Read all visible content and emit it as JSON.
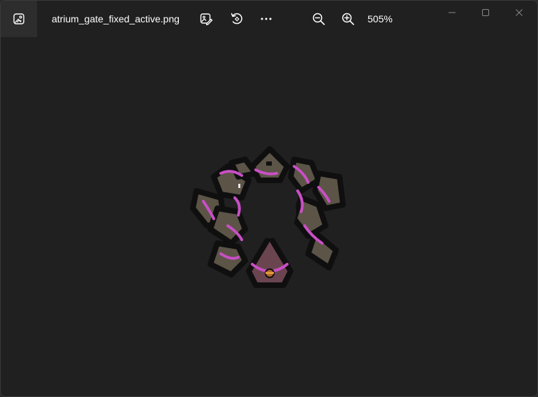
{
  "window": {
    "title": "atrium_gate_fixed_active.png",
    "zoom_level": "505%"
  },
  "toolbar": {
    "icons": [
      "photos-app-icon",
      "edit-image-icon",
      "rotate-icon",
      "more-icon",
      "zoom-out-icon",
      "zoom-in-icon"
    ]
  },
  "window_controls": [
    "minimize-icon",
    "maximize-icon",
    "close-icon"
  ],
  "colors": {
    "background": "#202020",
    "titlebar": "#202020",
    "icon_box": "#2d2d2d",
    "text": "#ffffff",
    "sprite_stone": "#5b5447",
    "sprite_glow": "#c94fc6",
    "sprite_outline": "#0f0f0f"
  }
}
